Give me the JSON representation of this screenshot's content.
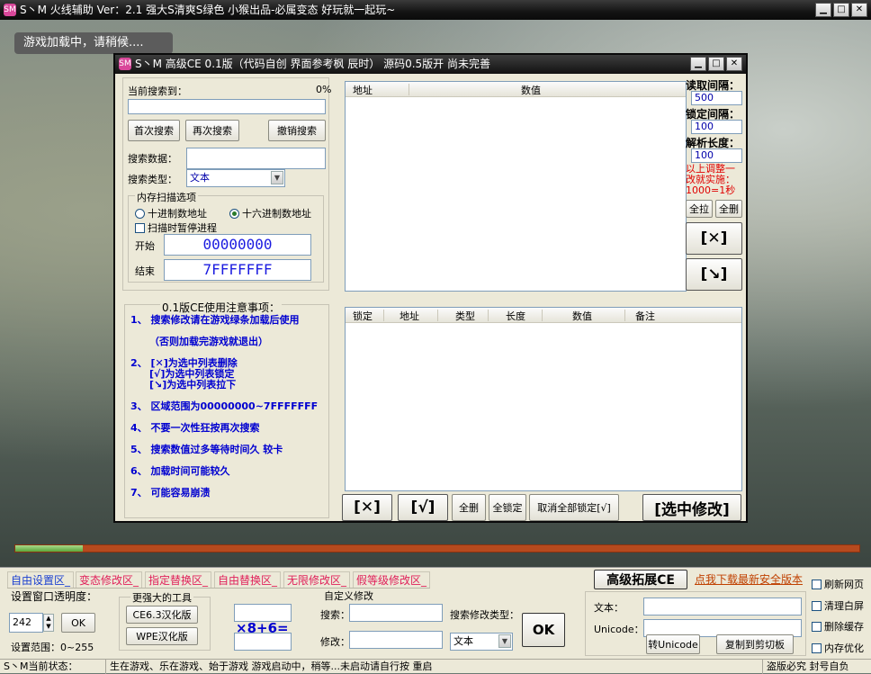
{
  "outer_window": {
    "icon_text": "SM",
    "title": "S丶M 火线辅助 Ver：2.1 强大S清爽S绿色 小猴出品-必属变态 好玩就一起玩~",
    "min": "▁",
    "max": "□",
    "close": "✕"
  },
  "loading_text": "游戏加载中，请稍候....",
  "game_progress_percent": 8,
  "ce": {
    "icon_text": "SM",
    "title": "S丶M 高级CE 0.1版（代码自创 界面参考枫 辰时） 源码0.5版开 尚未完善",
    "min": "▁",
    "max": "□",
    "close": "✕",
    "search_label": "当前搜索到：",
    "search_percent": "0%",
    "btn_first_search": "首次搜索",
    "btn_next_search": "再次搜索",
    "btn_undo_search": "撤销搜索",
    "search_value_label": "搜索数据：",
    "search_value": "",
    "search_type_label": "搜索类型：",
    "search_type_value": "文本",
    "mem_scan_title": "内存扫描选项",
    "radio_decimal": "十进制数地址",
    "radio_hex": "十六进制数地址",
    "check_pause": "扫描时暂停进程",
    "start_label": "开始",
    "start_value": "00000000",
    "end_label": "结束",
    "end_value": "7FFFFFFF",
    "results_columns": [
      "地址",
      "数值"
    ],
    "read_interval_label": "读取间隔：",
    "read_interval_value": "500",
    "lock_interval_label": "锁定间隔：",
    "lock_interval_value": "100",
    "parse_length_label": "解析长度：",
    "parse_length_value": "100",
    "red_note": "以上调整一改就实施：1000=1秒",
    "btn_select_all": "全拉",
    "btn_delete_all": "全删",
    "btn_remove": "[✕]",
    "btn_pulldown": "[↘]",
    "notes_title": "0.1版CE使用注意事项：",
    "notes": [
      "1、 搜索修改请在游戏绿条加载后使用",
      "（否则加载完游戏就退出）",
      "2、 [✕]为选中列表删除",
      "[√]为选中列表锁定",
      "[↘]为选中列表拉下",
      "3、 区域范围为00000000~7FFFFFFF",
      "4、 不要一次性狂按再次搜索",
      "5、 搜索数值过多等待时间久 较卡",
      "6、 加载时间可能较久",
      "7、 可能容易崩溃"
    ],
    "list_columns": [
      "锁定",
      "地址",
      "类型",
      "长度",
      "数值",
      "备注"
    ],
    "btn_bottom_delete": "[✕]",
    "btn_bottom_lock": "[√]",
    "btn_bottom_delete_all": "全删",
    "btn_bottom_lock_all": "全锁定",
    "btn_unlock_all": "取消全部锁定[√]",
    "btn_modify_selected": "[选中修改]"
  },
  "bottom": {
    "tabs": [
      {
        "label": "自由设置区_",
        "color": "#1a3fd0"
      },
      {
        "label": "变态修改区_",
        "color": "#e0205a"
      },
      {
        "label": "指定替换区_",
        "color": "#e0205a"
      },
      {
        "label": "自由替换区_",
        "color": "#e0205a"
      },
      {
        "label": "无限修改区_",
        "color": "#e0205a"
      },
      {
        "label": "假等级修改区_",
        "color": "#e0205a"
      }
    ],
    "advanced_ext": "高级拓展CE",
    "download_link": "点我下载最新安全版本",
    "opacity_label": "设置窗口透明度：",
    "opacity_value": "242",
    "btn_ok_small": "OK",
    "opacity_range": "设置范围：0~255",
    "tools_title": "更强大的工具",
    "btn_ce63": "CE6.3汉化版",
    "btn_wpe": "WPE汉化版",
    "calc_expr": "×8+6=",
    "custom_title": "自定义修改",
    "search_label": "搜索：",
    "search_value": "",
    "modify_label": "修改：",
    "modify_value": "",
    "modify_type_label": "搜索修改类型：",
    "modify_type_value": "文本",
    "btn_ok_big": "OK",
    "text_label": "文本：",
    "text_value": "",
    "unicode_label": "Unicode：",
    "unicode_value": "",
    "btn_to_unicode": "转Unicode",
    "btn_copy": "复制到剪切板",
    "checks": [
      "刷新网页",
      "清理白屏",
      "删除缓存",
      "内存优化"
    ]
  },
  "status": {
    "state": "S丶M当前状态：",
    "message": "生在游戏、乐在游戏、始于游戏  游戏启动中，稍等...未启动请自行按 重启",
    "right": "盗版必究 封号自负"
  }
}
